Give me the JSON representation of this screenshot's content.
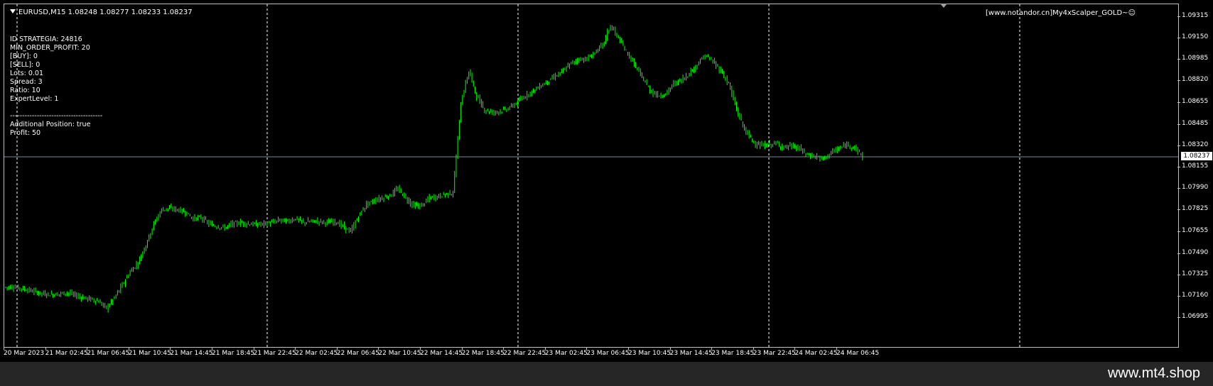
{
  "header": {
    "symbol_info": "EURUSD,M15  1.08248 1.08277 1.08233 1.08237",
    "ea_label": "[www.notandor.cn]My4xScalper_GOLD~",
    "ea_icon": "smiley-icon"
  },
  "info_panel": {
    "lines": [
      "ID STRATEGIA: 24816",
      "MIN_ORDER_PROFIT: 20",
      "[BUY]: 0",
      "[SELL]: 0",
      "Lots: 0.01",
      "Spread: 3",
      "Ratio: 10",
      "ExpertLevel: 1",
      "",
      "--------------------------------------",
      "Additional Position: true",
      "Profit: 50"
    ]
  },
  "current_price": "1.08237",
  "footer": {
    "site": "www.mt4.shop"
  },
  "colors": {
    "candle": "#00ff00",
    "background": "#000000",
    "price_line": "#778899",
    "grid": "#ffffff"
  },
  "chart_data": {
    "type": "line",
    "symbol": "EURUSD",
    "timeframe": "M15",
    "ohlc_last": {
      "open": 1.08248,
      "high": 1.08277,
      "low": 1.08233,
      "close": 1.08237
    },
    "y_ticks": [
      "1.09315",
      "1.09150",
      "1.08985",
      "1.08820",
      "1.08655",
      "1.08485",
      "1.08320",
      "1.08155",
      "1.07990",
      "1.07825",
      "1.07655",
      "1.07490",
      "1.07325",
      "1.07160",
      "1.06995"
    ],
    "ylim": [
      1.06995,
      1.09315
    ],
    "x_ticks": [
      "20 Mar 2023",
      "21 Mar 02:45",
      "21 Mar 06:45",
      "21 Mar 10:45",
      "21 Mar 14:45",
      "21 Mar 18:45",
      "21 Mar 22:45",
      "22 Mar 02:45",
      "22 Mar 06:45",
      "22 Mar 10:45",
      "22 Mar 14:45",
      "22 Mar 18:45",
      "22 Mar 22:45",
      "23 Mar 02:45",
      "23 Mar 06:45",
      "23 Mar 10:45",
      "23 Mar 14:45",
      "23 Mar 18:45",
      "23 Mar 22:45",
      "24 Mar 02:45",
      "24 Mar 06:45"
    ],
    "series": [
      {
        "values": [
          1.0723,
          1.07235,
          1.07225,
          1.0721,
          1.07195,
          1.0718,
          1.07175,
          1.0718,
          1.0719,
          1.0717,
          1.0715,
          1.0714,
          1.0712,
          1.0707,
          1.0715,
          1.0725,
          1.0735,
          1.0742,
          1.0756,
          1.0772,
          1.0783,
          1.0784,
          1.0783,
          1.0781,
          1.0776,
          1.0777,
          1.0772,
          1.077,
          1.0769,
          1.0772,
          1.0773,
          1.0772,
          1.07715,
          1.0772,
          1.0773,
          1.0775,
          1.0774,
          1.0776,
          1.0773,
          1.0774,
          1.0774,
          1.0773,
          1.0774,
          1.077,
          1.0766,
          1.0778,
          1.0787,
          1.079,
          1.0792,
          1.0794,
          1.0799,
          1.0792,
          1.0786,
          1.0786,
          1.0792,
          1.0793,
          1.0795,
          1.0796,
          1.0865,
          1.089,
          1.087,
          1.086,
          1.0858,
          1.0859,
          1.0861,
          1.0865,
          1.087,
          1.0874,
          1.0878,
          1.0882,
          1.0886,
          1.089,
          1.0896,
          1.0899,
          1.0899,
          1.0904,
          1.091,
          1.0925,
          1.0915,
          1.0905,
          1.0895,
          1.0885,
          1.0875,
          1.0871,
          1.0872,
          1.088,
          1.0883,
          1.0888,
          1.0895,
          1.0902,
          1.0897,
          1.089,
          1.088,
          1.086,
          1.0845,
          1.0836,
          1.0832,
          1.0833,
          1.0834,
          1.0831,
          1.0832,
          1.083,
          1.0825,
          1.0824,
          1.0822,
          1.0827,
          1.083,
          1.0833,
          1.0831,
          1.08237
        ]
      }
    ],
    "grid": true,
    "price_line": 1.08237
  }
}
